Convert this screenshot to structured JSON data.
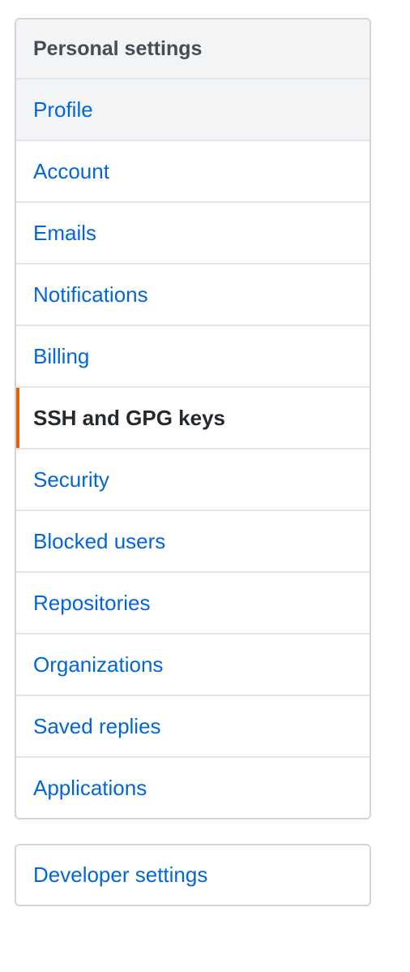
{
  "personal_settings": {
    "header": "Personal settings",
    "items": [
      {
        "label": "Profile"
      },
      {
        "label": "Account"
      },
      {
        "label": "Emails"
      },
      {
        "label": "Notifications"
      },
      {
        "label": "Billing"
      },
      {
        "label": "SSH and GPG keys"
      },
      {
        "label": "Security"
      },
      {
        "label": "Blocked users"
      },
      {
        "label": "Repositories"
      },
      {
        "label": "Organizations"
      },
      {
        "label": "Saved replies"
      },
      {
        "label": "Applications"
      }
    ],
    "selected": "SSH and GPG keys"
  },
  "developer_settings": {
    "label": "Developer settings"
  },
  "colors": {
    "link": "#0366d6",
    "selected_text": "#24292e",
    "selected_accent": "#e36209",
    "header_bg": "#f3f4f6",
    "border": "#d1d5da"
  }
}
